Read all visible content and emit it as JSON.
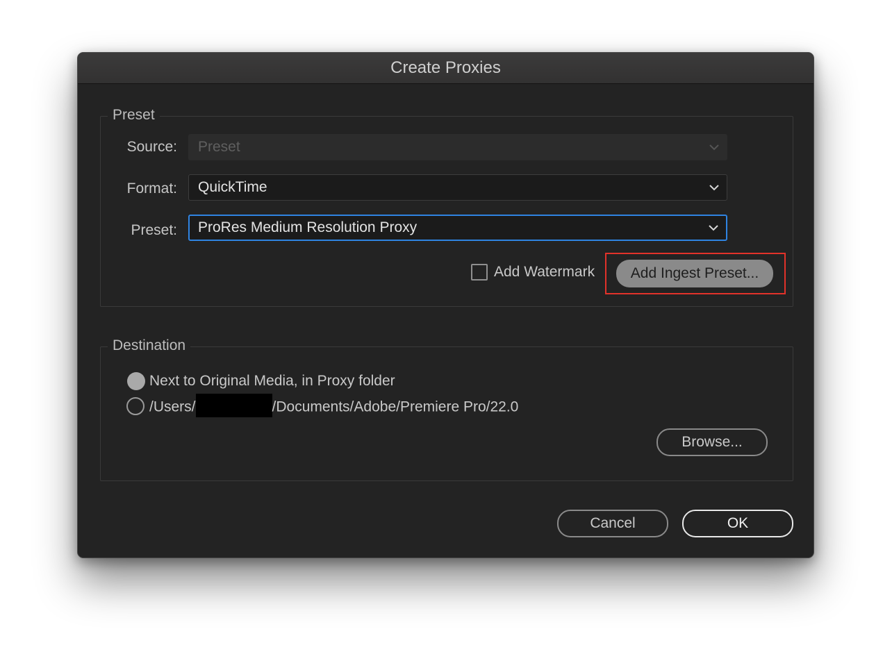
{
  "dialog": {
    "title": "Create Proxies"
  },
  "preset_group": {
    "legend": "Preset",
    "source": {
      "label": "Source:",
      "value": "Preset",
      "disabled": true
    },
    "format": {
      "label": "Format:",
      "value": "QuickTime"
    },
    "preset": {
      "label": "Preset:",
      "value": "ProRes Medium Resolution Proxy",
      "focused": true
    },
    "watermark": {
      "label": "Add Watermark",
      "checked": false
    },
    "add_ingest_button": "Add Ingest Preset..."
  },
  "destination_group": {
    "legend": "Destination",
    "options": [
      {
        "label": "Next to Original Media, in Proxy folder",
        "selected": true
      },
      {
        "label_prefix": "/Users/",
        "label_suffix": "/Documents/Adobe/Premiere Pro/22.0",
        "selected": false
      }
    ],
    "browse_button": "Browse..."
  },
  "footer": {
    "cancel_button": "Cancel",
    "ok_button": "OK"
  },
  "icons": {
    "dropdown": "chevron-down-icon",
    "radio": "radio-icon",
    "checkbox": "checkbox-icon"
  },
  "colors": {
    "dialog_bg": "#232323",
    "focus_ring": "#2f84e2",
    "highlight": "#e2322a"
  }
}
